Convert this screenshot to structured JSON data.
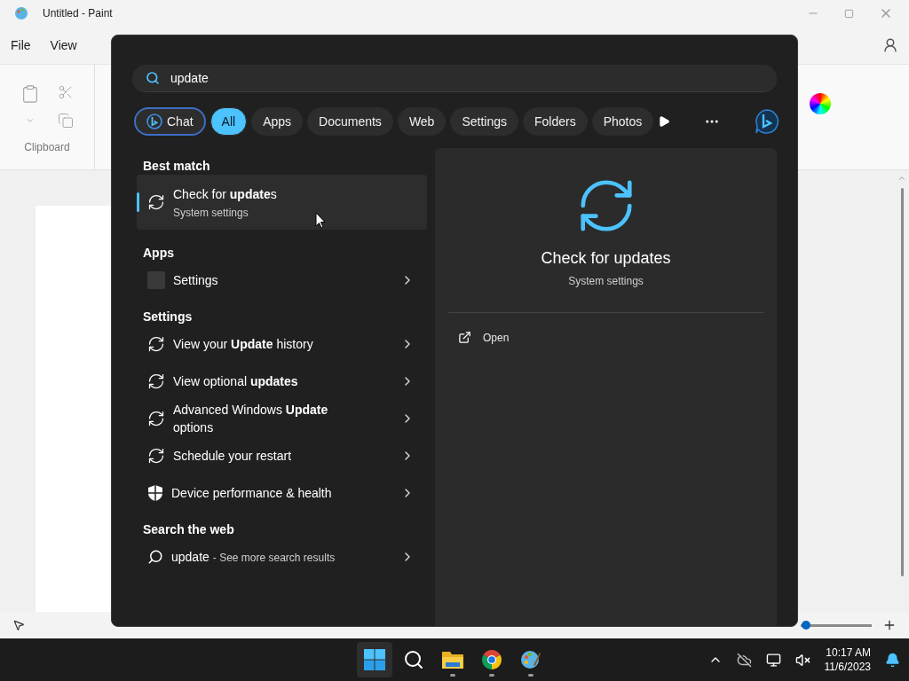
{
  "window": {
    "title": "Untitled - Paint"
  },
  "menu": [
    "File",
    "View"
  ],
  "ribbon": {
    "group_label": "Clipboard"
  },
  "zoom_slider": {
    "level": 0.02
  },
  "search": {
    "query": "update",
    "filters": [
      {
        "label": "Chat",
        "kind": "chat",
        "selected": false
      },
      {
        "label": "All",
        "kind": "chip",
        "selected": true
      },
      {
        "label": "Apps",
        "kind": "chip",
        "selected": false
      },
      {
        "label": "Documents",
        "kind": "chip",
        "selected": false
      },
      {
        "label": "Web",
        "kind": "chip",
        "selected": false
      },
      {
        "label": "Settings",
        "kind": "chip",
        "selected": false
      },
      {
        "label": "Folders",
        "kind": "chip",
        "selected": false
      },
      {
        "label": "Photos",
        "kind": "chip",
        "selected": false
      }
    ],
    "sections": [
      {
        "heading": "Best match",
        "items": [
          {
            "kind": "best",
            "title": "Check for **update**s",
            "subtitle": "System settings",
            "selected": true
          }
        ]
      },
      {
        "heading": "Apps",
        "items": [
          {
            "kind": "app",
            "title": "Settings",
            "selected": false
          }
        ]
      },
      {
        "heading": "Settings",
        "items": [
          {
            "kind": "sync",
            "title": "View your **Update** history",
            "selected": false
          },
          {
            "kind": "sync",
            "title": "View optional **updates**",
            "selected": false
          },
          {
            "kind": "sync",
            "title": "Advanced Windows **Update** options",
            "selected": false
          },
          {
            "kind": "sync",
            "title": "Schedule your restart",
            "selected": false
          },
          {
            "kind": "shield",
            "title": "Device performance & health",
            "selected": false
          }
        ]
      },
      {
        "heading": "Search the web",
        "items": [
          {
            "kind": "web",
            "title": "update",
            "subtitle": "- See more search results",
            "selected": false
          }
        ]
      }
    ],
    "preview": {
      "title": "Check for updates",
      "subtitle": "System settings",
      "actions": [
        "Open"
      ]
    }
  },
  "taskbar": {
    "apps": [
      {
        "kind": "start",
        "selected": true,
        "running": false
      },
      {
        "kind": "search",
        "selected": false,
        "running": false
      },
      {
        "kind": "explorer",
        "selected": false,
        "running": true
      },
      {
        "kind": "chrome",
        "selected": false,
        "running": true
      },
      {
        "kind": "paint",
        "selected": false,
        "running": true
      }
    ],
    "time": "10:17 AM",
    "date": "11/6/2023"
  }
}
